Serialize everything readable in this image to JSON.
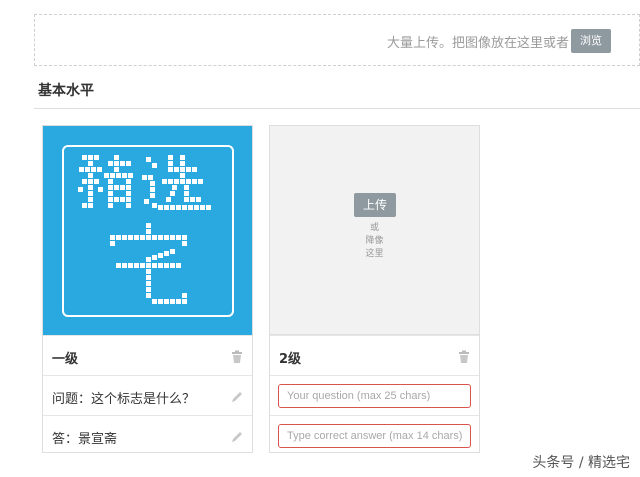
{
  "upload_zone": {
    "hint": "大量上传。把图像放在这里或者",
    "browse_label": "浏览"
  },
  "section": {
    "title": "基本水平"
  },
  "cards": [
    {
      "image": {
        "logo_text": "精选宅",
        "bg_color": "#2aa9e0"
      },
      "level_name": "一级",
      "question": "问题：这个标志是什么？",
      "answer": "答：景宣斋"
    },
    {
      "upload_label": "上传",
      "drop_hint": [
        "或",
        "降像",
        "这里"
      ],
      "level_name": "2级",
      "question_placeholder": "Your question (max 25 chars)",
      "answer_placeholder": "Type correct answer (max 14 chars)",
      "field_border_color": "#d9534f"
    }
  ],
  "icons": {
    "delete": "trash-icon",
    "edit": "pencil-icon"
  },
  "watermark": "头条号 / 精选宅"
}
